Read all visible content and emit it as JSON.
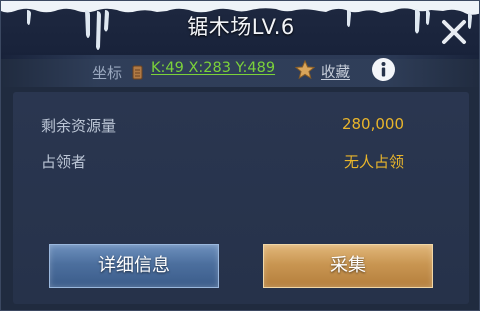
{
  "dialog": {
    "title": "锯木场LV.6"
  },
  "location": {
    "label": "坐标",
    "coordinates": "K:49  X:283  Y:489",
    "favorite_label": "收藏"
  },
  "details": {
    "remaining_label": "剩余资源量",
    "remaining_value": "280,000",
    "occupant_label": "占领者",
    "occupant_value": "无人占领"
  },
  "actions": {
    "detail_label": "详细信息",
    "gather_label": "采集"
  },
  "colors": {
    "coordinate_link": "#7bd23a",
    "value_gold": "#e9b52b",
    "detail_button": "#4c6f9e",
    "gather_button": "#c99652"
  },
  "icons": {
    "close": "close-icon",
    "scroll": "scroll-icon",
    "favorite": "star-icon",
    "info": "info-icon"
  }
}
